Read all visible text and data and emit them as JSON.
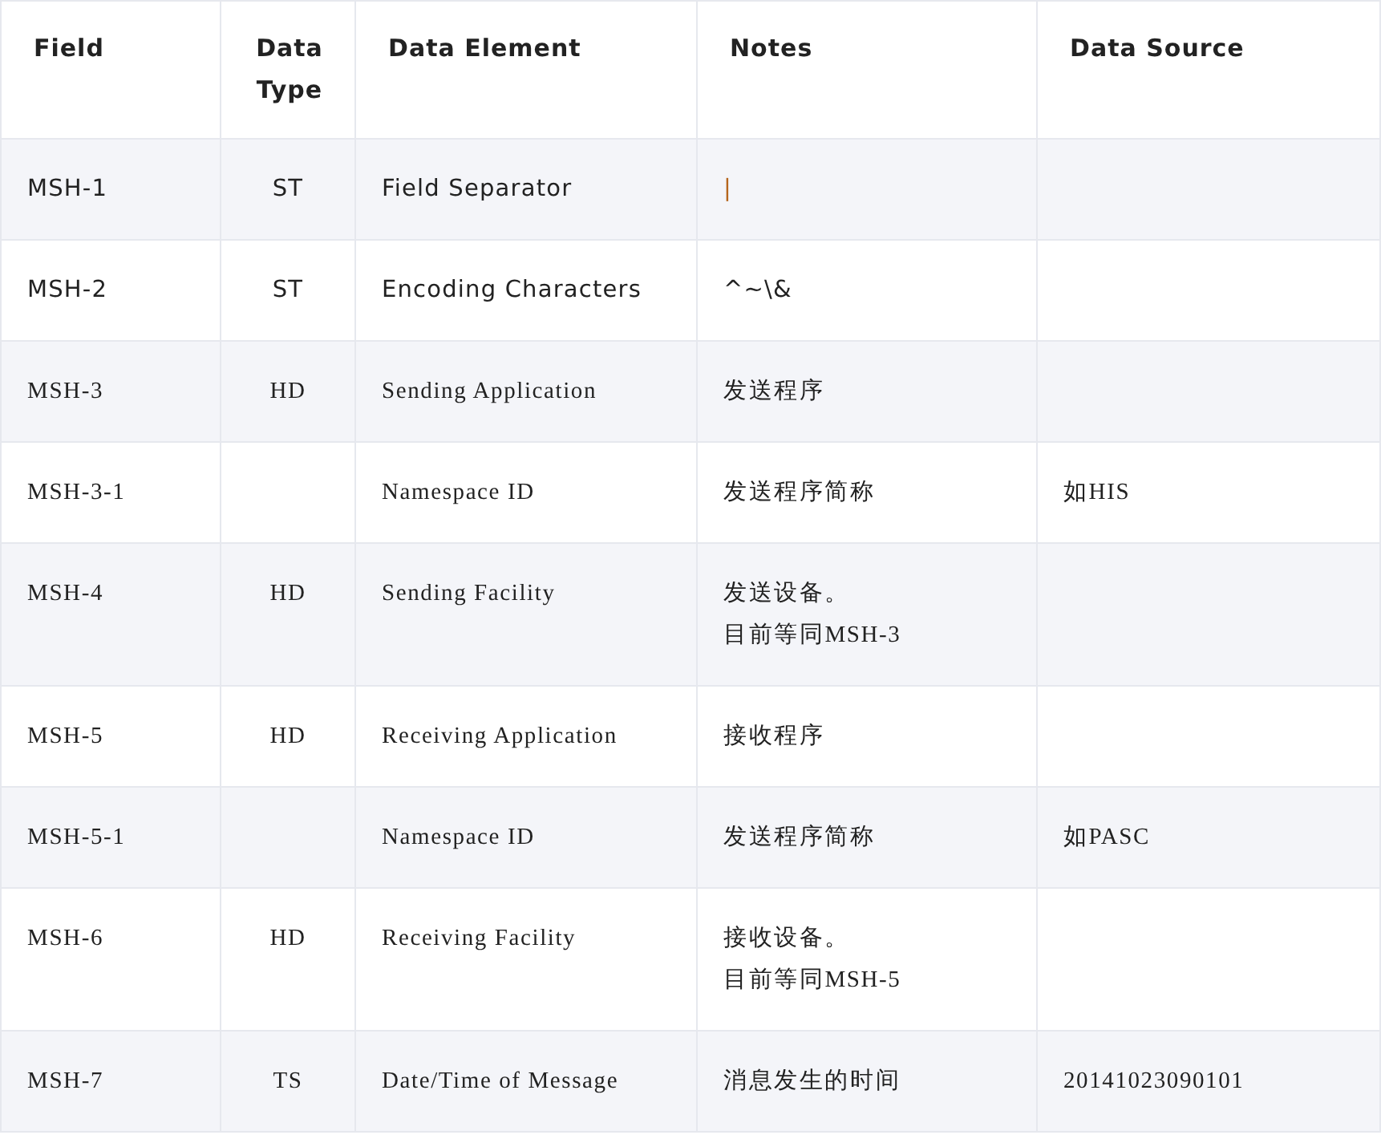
{
  "table": {
    "columns": [
      {
        "label": "Field"
      },
      {
        "label": "Data Type"
      },
      {
        "label": "Data Element"
      },
      {
        "label": "Notes"
      },
      {
        "label": "Data Source"
      }
    ],
    "rows": [
      {
        "kind": "sans",
        "field": "MSH-1",
        "type": "ST",
        "element": "Field Separator",
        "notes": [
          {
            "kind": "code",
            "text": "|"
          }
        ],
        "source": ""
      },
      {
        "kind": "sans",
        "field": "MSH-2",
        "type": "ST",
        "element": "Encoding Characters",
        "notes": [
          {
            "kind": "plain",
            "text": "^~\\&"
          }
        ],
        "source": ""
      },
      {
        "kind": "serif",
        "field": "MSH-3",
        "type": "HD",
        "element": "Sending Application",
        "notes": [
          {
            "kind": "plain",
            "text": "发送程序"
          }
        ],
        "source": ""
      },
      {
        "kind": "serif",
        "field": "MSH-3-1",
        "type": "",
        "element": "Namespace ID",
        "notes": [
          {
            "kind": "plain",
            "text": "发送程序简称"
          }
        ],
        "source": "如HIS"
      },
      {
        "kind": "serif",
        "field": "MSH-4",
        "type": "HD",
        "element": "Sending Facility",
        "notes": [
          {
            "kind": "plain",
            "text": "发送设备。"
          },
          {
            "kind": "plain",
            "text": "目前等同MSH-3"
          }
        ],
        "source": ""
      },
      {
        "kind": "serif",
        "field": "MSH-5",
        "type": "HD",
        "element": "Receiving Application",
        "notes": [
          {
            "kind": "plain",
            "text": "接收程序"
          }
        ],
        "source": ""
      },
      {
        "kind": "serif",
        "field": "MSH-5-1",
        "type": "",
        "element": "Namespace ID",
        "notes": [
          {
            "kind": "plain",
            "text": "发送程序简称"
          }
        ],
        "source": "如PASC"
      },
      {
        "kind": "serif",
        "field": "MSH-6",
        "type": "HD",
        "element": "Receiving Facility",
        "notes": [
          {
            "kind": "plain",
            "text": "接收设备。"
          },
          {
            "kind": "plain",
            "text": "目前等同MSH-5"
          }
        ],
        "source": ""
      },
      {
        "kind": "serif",
        "field": "MSH-7",
        "type": "TS",
        "element": "Date/Time of Message",
        "notes": [
          {
            "kind": "plain",
            "text": "消息发生的时间"
          }
        ],
        "source": "20141023090101"
      }
    ]
  }
}
